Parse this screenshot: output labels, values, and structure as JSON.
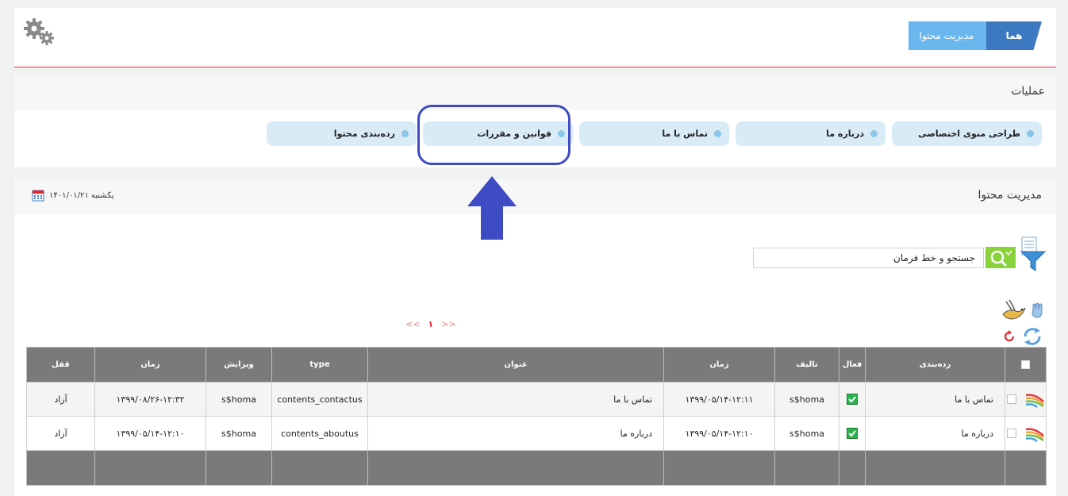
{
  "breadcrumb": {
    "home": "هما",
    "current": "مدیریت محتوا"
  },
  "operations": {
    "title": "عملیات",
    "tabs": [
      {
        "label": "طراحی منوی اختصاصی"
      },
      {
        "label": "درباره ما"
      },
      {
        "label": "تماس با ما"
      },
      {
        "label": "قوانین و مقررات"
      },
      {
        "label": "رده‌بندی محتوا"
      }
    ]
  },
  "content": {
    "title": "مدیریت محتوا",
    "date": "یکشنبه ۱۴۰۱/۰۱/۲۱",
    "search": {
      "value": "جستجو و خط فرمان"
    },
    "pager": {
      "prev": "<<",
      "current": "۱",
      "next": ">>"
    }
  },
  "table": {
    "headers": {
      "category": "رده‌بندی",
      "active": "فعال",
      "author": "تالیف",
      "time1": "زمان",
      "title": "عنوان",
      "type": "type",
      "editor": "ویرایش",
      "time2": "زمان",
      "lock": "قفل"
    },
    "rows": [
      {
        "category": "تماس با ما",
        "author": "s$homa",
        "time1": "۱۳۹۹/۰۵/۱۴-۱۲:۱۱",
        "title": "تماس با ما",
        "type": "contents_contactus",
        "editor": "s$homa",
        "time2": "۱۳۹۹/۰۸/۲۶-۱۲:۳۲",
        "lock": "آزاد",
        "active": true
      },
      {
        "category": "درباره ما",
        "author": "s$homa",
        "time1": "۱۳۹۹/۰۵/۱۴-۱۲:۱۰",
        "title": "درباره ما",
        "type": "contents_aboutus",
        "editor": "s$homa",
        "time2": "۱۳۹۹/۰۵/۱۴-۱۲:۱۰",
        "lock": "آزاد",
        "active": true
      }
    ]
  },
  "colors": {
    "accent": "#3d79c0",
    "breadcrumb_light": "#6ab7f0",
    "divider": "#e2262d",
    "tab_bg": "#d8ebf6",
    "highlight": "#3f4bc4",
    "header_bg": "#7a7a7a",
    "search_green": "#8ad23b",
    "active_green": "#2bb24c"
  },
  "icons": [
    "gear-icon",
    "calendar-icon",
    "filter-icon",
    "search-icon",
    "bird-icon",
    "hand-icon",
    "reload-icon",
    "sync-icon",
    "rainbow-icon",
    "check-icon",
    "arrow-up-icon"
  ]
}
